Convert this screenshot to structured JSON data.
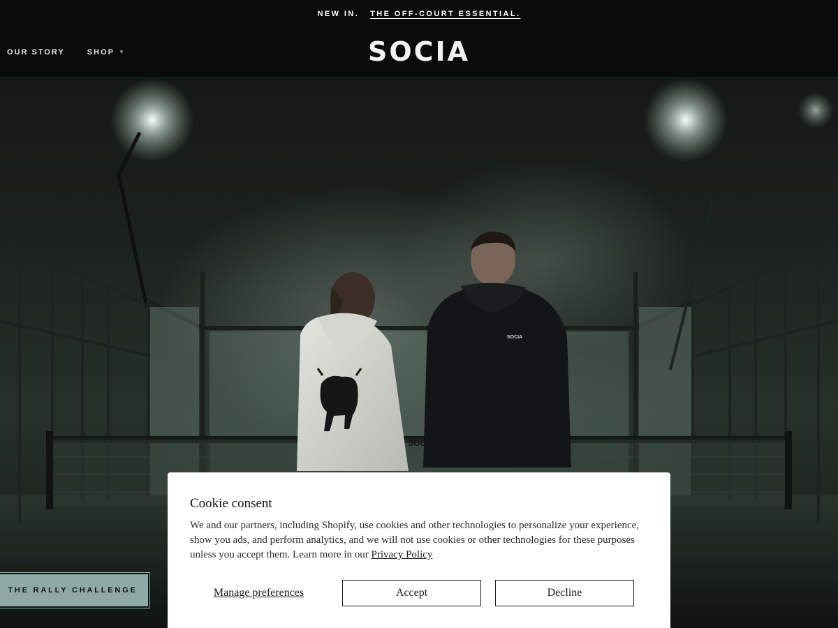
{
  "announcement": {
    "lead": "NEW IN.",
    "link": "THE OFF-COURT ESSENTIAL."
  },
  "header": {
    "logo": "SOCIA",
    "nav": [
      {
        "label": "OUR STORY"
      },
      {
        "label": "SHOP",
        "has_dropdown": true
      }
    ]
  },
  "hero": {
    "hoodie_text": "SOCIA",
    "net_text": "SOCI"
  },
  "rally_button": "THE RALLY CHALLENGE",
  "cookie": {
    "title": "Cookie consent",
    "body": "We and our partners, including Shopify, use cookies and other technologies to personalize your experience, show you ads, and perform analytics, and we will not use cookies or other technologies for these purposes unless you accept them. Learn more in our",
    "policy_link": "Privacy Policy",
    "manage_label": "Manage preferences",
    "accept_label": "Accept",
    "decline_label": "Decline"
  },
  "colors": {
    "header_bg": "#0b0b0b",
    "rally_bg": "#8fa9a4",
    "modal_bg": "#ffffff"
  },
  "icons": {
    "dropdown": "chevron-down-icon"
  }
}
